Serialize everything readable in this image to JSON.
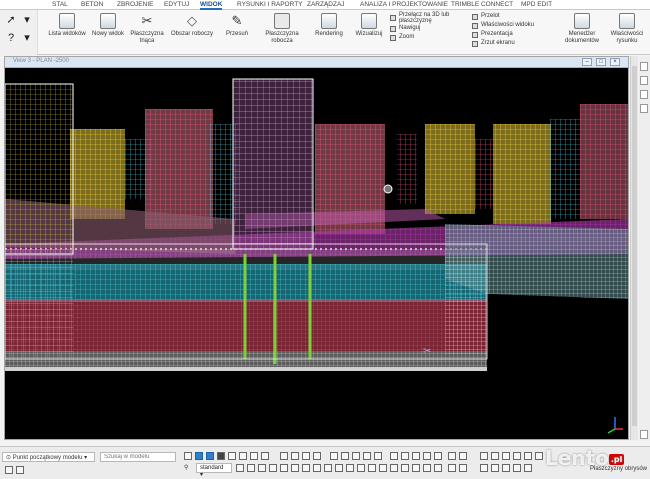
{
  "menu": {
    "items": [
      "STAL",
      "BETON",
      "ZBROJENIE",
      "EDYTUJ",
      "WIDOK",
      "RYSUNKI I RAPORTY",
      "ZARZĄDZAJ",
      "ANALIZA I PROJEKTOWANIE",
      "TRIMBLE CONNECT",
      "MPD EDIT"
    ],
    "active": "WIDOK"
  },
  "ribbon": {
    "lista_widokow": "Lista widoków",
    "nowy_widok": "Nowy widok",
    "plaszczyzna_tnaca": "Płaszczyzna\ntnąca",
    "obszar_roboczy": "Obszar roboczy",
    "przesun": "Przesuń",
    "plaszczyzna_robocza": "Płaszczyzna\nrobocza",
    "rendering": "Rendering",
    "wizualizuj": "Wizualizuj",
    "przelacz_3d": "Przełącz na 3D lub\npłaszczyznę",
    "nawiguj": "Nawiguj",
    "zoom": "Zoom",
    "przelot": "Przelot",
    "wlasciwosci_widoku": "Właściwości widoku",
    "prezentacja": "Prezentacja",
    "zrzut_ekranu": "Zrzut ekranu",
    "menedzer_dokumentow": "Menedżer\ndokumentów",
    "wlasciwosci_rysunku": "Właściwości\nrysunku"
  },
  "view": {
    "title": "View 3 - PLAN -2500"
  },
  "status": {
    "model_origin": "Punkt początkowy modelu",
    "search_placeholder": "Szukaj w modelu",
    "standard": "standard",
    "plaszczyzny_obrysow": "Płaszczyzny obrysów"
  },
  "watermark": {
    "text": "Lento",
    "badge": ".pl"
  },
  "colors": {
    "accent": "#1f6fc5",
    "viewport_bg": "#000000",
    "rebar_green": "#7dd23a",
    "rebar_pink": "#ff5a8a",
    "rebar_yellow": "#ffe04a",
    "rebar_cyan": "#4fd8e8",
    "rebar_purple": "#c43ccf"
  }
}
